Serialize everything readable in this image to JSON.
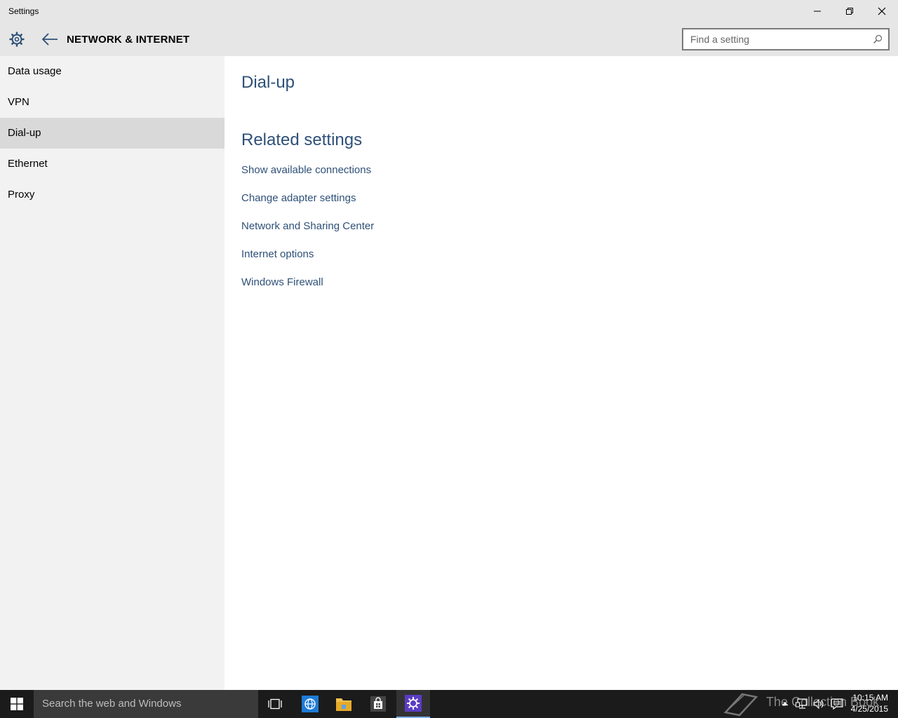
{
  "window": {
    "title": "Settings",
    "minimize_icon": "minimize-icon",
    "restore_icon": "restore-icon",
    "close_icon": "close-icon"
  },
  "header": {
    "section_title": "NETWORK & INTERNET",
    "search_placeholder": "Find a setting"
  },
  "sidebar": {
    "items": [
      {
        "label": "Data usage",
        "selected": false
      },
      {
        "label": "VPN",
        "selected": false
      },
      {
        "label": "Dial-up",
        "selected": true
      },
      {
        "label": "Ethernet",
        "selected": false
      },
      {
        "label": "Proxy",
        "selected": false
      }
    ]
  },
  "main": {
    "page_title": "Dial-up",
    "related_title": "Related settings",
    "links": [
      "Show available connections",
      "Change adapter settings",
      "Network and Sharing Center",
      "Internet options",
      "Windows Firewall"
    ]
  },
  "taskbar": {
    "search_placeholder": "Search the web and Windows",
    "apps": [
      "task-view-icon",
      "ie-icon",
      "file-explorer-icon",
      "store-icon",
      "settings-icon"
    ],
    "watermark": "The Collection Book",
    "time": "10:15 AM",
    "date": "4/25/2015"
  },
  "colors": {
    "accent_text": "#2e5078",
    "chrome_bg": "#e6e6e6",
    "sidebar_bg": "#f2f2f2",
    "selected_bg": "#d9d9d9",
    "taskbar_bg": "#1b1b1b"
  }
}
